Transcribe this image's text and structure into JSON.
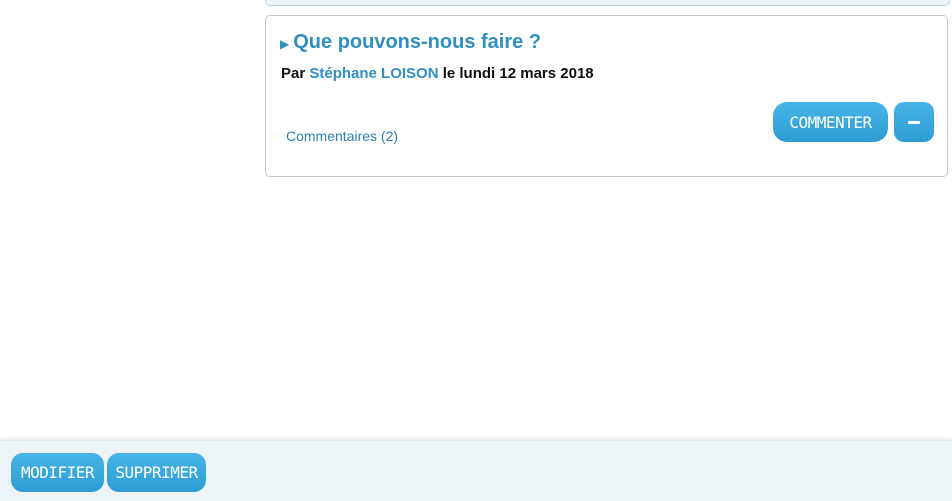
{
  "post": {
    "title": "Que pouvons-nous faire ?",
    "byline_prefix": "Par ",
    "author": "Stéphane LOISON",
    "byline_suffix": " le lundi 12 mars 2018",
    "comments_link": "Commentaires (2)",
    "comment_button": "COMMENTER",
    "collapse_icon": "minus-icon"
  },
  "bottom_toolbar": {
    "modify_button": "MODIFIER",
    "delete_button": "SUPPRIMER"
  },
  "colors": {
    "accent": "#2f8fc3",
    "button": "#3aa8dd",
    "toolbar_bg": "#edf4f8"
  }
}
